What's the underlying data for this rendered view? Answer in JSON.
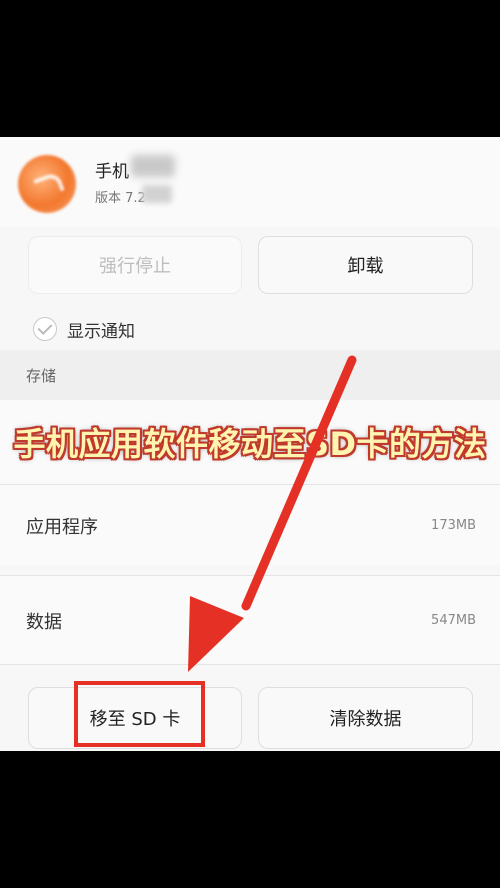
{
  "app": {
    "name": "手机",
    "version": "版本 7.2"
  },
  "actions": {
    "force_stop_label": "强行停止",
    "uninstall_label": "卸载"
  },
  "notification": {
    "label": "显示通知"
  },
  "storage": {
    "header": "存储",
    "rows": [
      {
        "label": "应用程序",
        "value": "173MB"
      },
      {
        "label": "数据",
        "value": "547MB"
      }
    ],
    "move_to_sd_label": "移至 SD 卡",
    "clear_data_label": "清除数据"
  },
  "overlay": {
    "title": "手机应用软件移动至SD卡的方法"
  },
  "colors": {
    "annotation_red": "#e53125",
    "title_fill": "#fff5b0",
    "title_outline": "#c0392b"
  }
}
